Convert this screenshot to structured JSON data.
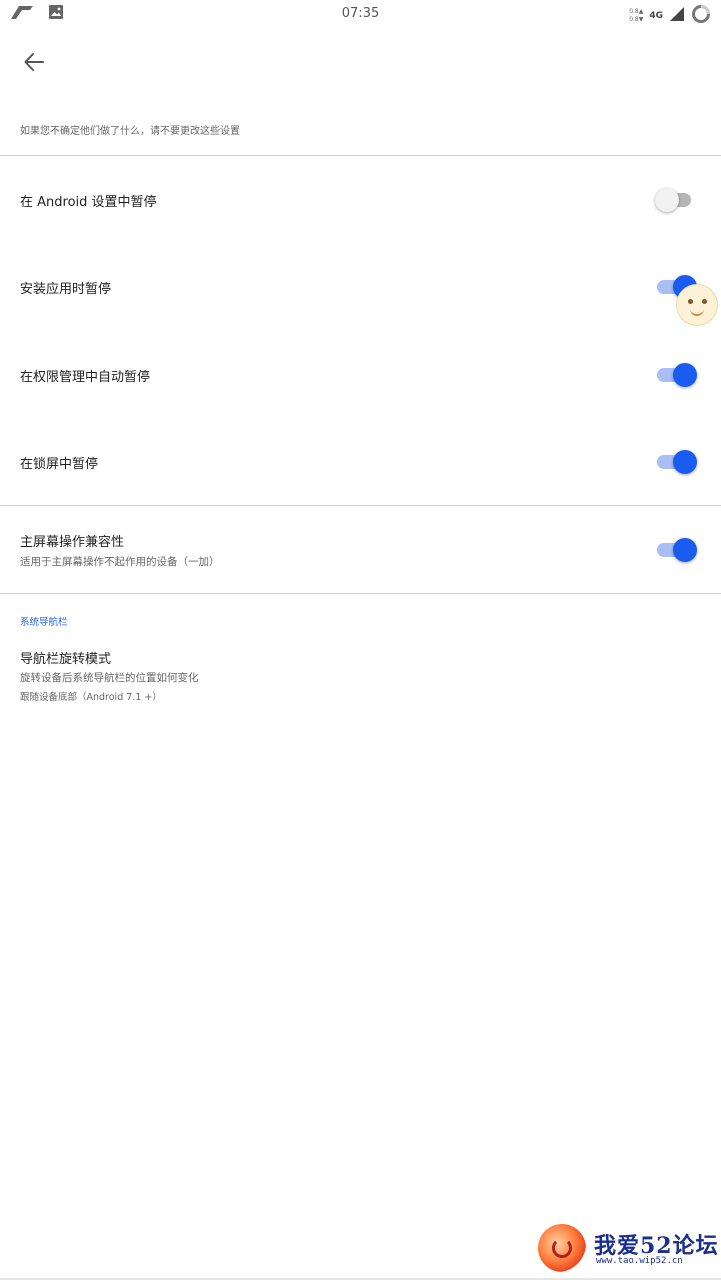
{
  "status_bar": {
    "time": "07:35",
    "net_up": "0.8▲",
    "net_down": "0.8▼",
    "network": "4G"
  },
  "header": {
    "warning": "如果您不确定他们做了什么，请不要更改这些设置"
  },
  "settings": [
    {
      "title": "在 Android 设置中暂停",
      "enabled": false
    },
    {
      "title": "安装应用时暂停",
      "enabled": true
    },
    {
      "title": "在权限管理中自动暂停",
      "enabled": true
    },
    {
      "title": "在锁屏中暂停",
      "enabled": true
    },
    {
      "title": "主屏幕操作兼容性",
      "subtitle": "适用于主屏幕操作不起作用的设备（一加）",
      "enabled": true
    }
  ],
  "nav_section": {
    "header": "系统导航栏",
    "item_title": "导航栏旋转模式",
    "item_subtitle": "旋转设备后系统导航栏的位置如何变化",
    "item_value": "跟随设备底部（Android 7.1 +）"
  },
  "watermark": {
    "text": "我爱52论坛",
    "url": "www.tao.wip52.cn"
  },
  "colors": {
    "accent": "#1a5cf0",
    "track_on": "#a7bff5",
    "section_header": "#2a63e8"
  },
  "icons": {
    "back": "arrow-left",
    "status_left_1": "app-logo",
    "status_left_2": "image",
    "status_right_signal": "signal",
    "status_right_battery": "battery-ring"
  }
}
